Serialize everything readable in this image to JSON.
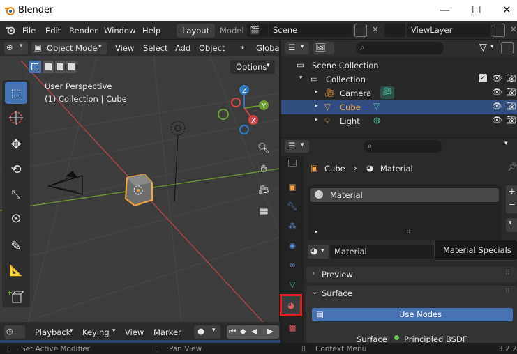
{
  "window": {
    "title": "Blender"
  },
  "menu": {
    "items": [
      "File",
      "Edit",
      "Render",
      "Window",
      "Help"
    ],
    "tab_active": "Layout",
    "tab_next": "Model",
    "scene": "Scene",
    "view_layer": "ViewLayer"
  },
  "viewport": {
    "header": {
      "mode": "Object Mode",
      "menus": [
        "View",
        "Select",
        "Add",
        "Object"
      ],
      "orientation": "Global"
    },
    "options_label": "Options",
    "info_line1": "User Perspective",
    "info_line2": "(1) Collection | Cube",
    "gizmo": {
      "x": "X",
      "y": "Y",
      "z": "Z"
    }
  },
  "timeline": {
    "playback": "Playback",
    "keying": "Keying",
    "view": "View",
    "marker": "Marker"
  },
  "status": {
    "left": "Set Active Modifier",
    "mid": "Pan View",
    "right": "Context Menu",
    "version": "3.2.2"
  },
  "outliner": {
    "scene_collection": "Scene Collection",
    "collection": "Collection",
    "items": [
      {
        "name": "Camera",
        "selected": false
      },
      {
        "name": "Cube",
        "selected": true
      },
      {
        "name": "Light",
        "selected": false
      }
    ]
  },
  "properties": {
    "breadcrumb_object": "Cube",
    "breadcrumb_material": "Material",
    "slot_name": "Material",
    "material_selector": "Material",
    "tooltip": "Material Specials",
    "preview_label": "Preview",
    "surface_label": "Surface",
    "use_nodes_label": "Use Nodes",
    "surface_field_label": "Surface",
    "surface_shader": "Principled BSDF"
  },
  "colors": {
    "accent": "#4772b3",
    "selected_row": "#334d80",
    "highlight_box": "#e02020",
    "active_object": "#f4a23a"
  }
}
